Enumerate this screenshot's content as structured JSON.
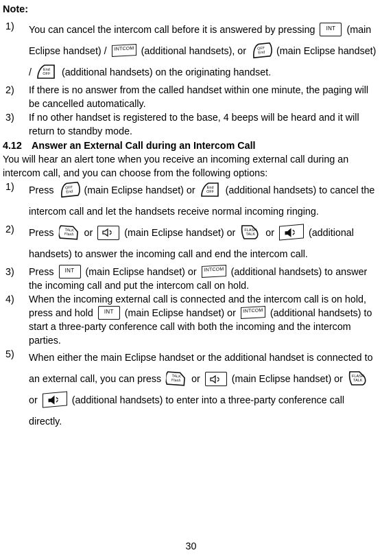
{
  "document": {
    "note_heading": "Note:",
    "page_number": "30"
  },
  "note_list": [
    {
      "marker": "1)",
      "seg_a": "You can cancel the intercom call before it is answered by pressing",
      "seg_b": "(main Eclipse handset) /",
      "seg_c": "(additional handsets), or",
      "seg_d": "(main Eclipse handset) /",
      "seg_e": "(additional handsets) on the",
      "seg_f": "originating handset."
    },
    {
      "marker": "2)",
      "text": "If there is no answer from the called handset within one minute, the paging will be cancelled automatically."
    },
    {
      "marker": "3)",
      "text": "If no other handset is registered to the base, 4 beeps will be heard and it will return to standby mode."
    }
  ],
  "section": {
    "number": "4.12",
    "title": "Answer an External Call during an Intercom Call",
    "intro": "You will hear an alert tone when you receive an incoming external call during an intercom call, and you can choose from the following options:"
  },
  "section_list": [
    {
      "marker": "1)",
      "seg_a": "Press",
      "seg_b": "(main Eclipse handset) or",
      "seg_c": "(additional handsets) to",
      "seg_d": "cancel the intercom call and let the handsets receive normal",
      "seg_e": "incoming ringing."
    },
    {
      "marker": "2)",
      "seg_a": "Press",
      "seg_b": "or",
      "seg_c": "(main Eclipse handset) or",
      "seg_d": "or",
      "seg_e": "(additional handsets) to answer the incoming call and end the",
      "seg_f": "intercom call."
    },
    {
      "marker": "3)",
      "seg_a": "Press",
      "seg_b": "(main Eclipse handset) or",
      "seg_c": "(additional handsets) to",
      "seg_d": "answer the incoming call and put the intercom call on hold."
    },
    {
      "marker": "4)",
      "seg_a": "When the incoming external call is connected and the intercom call",
      "seg_b": "is on hold, press and hold",
      "seg_c": "(main Eclipse handset) or",
      "seg_d": "(additional handsets) to start a three-party conference call with",
      "seg_e": "both the incoming and the intercom parties."
    },
    {
      "marker": "5)",
      "seg_a": "When either the main Eclipse handset or the additional handset is",
      "seg_b": "connected to an external call, you can press",
      "seg_c": "or",
      "seg_d": "(main",
      "seg_e": "Eclipse handset) or",
      "seg_f": "or",
      "seg_g": "(additional handsets) to enter into",
      "seg_h": "a three-party conference call directly."
    }
  ],
  "keys": {
    "int": "INT",
    "intcom": "INTCOM",
    "off": "OFF",
    "end": "End",
    "talk": "TALK",
    "flash": "Flash",
    "flash_small": "FLASH",
    "talk_caps": "TALK"
  }
}
